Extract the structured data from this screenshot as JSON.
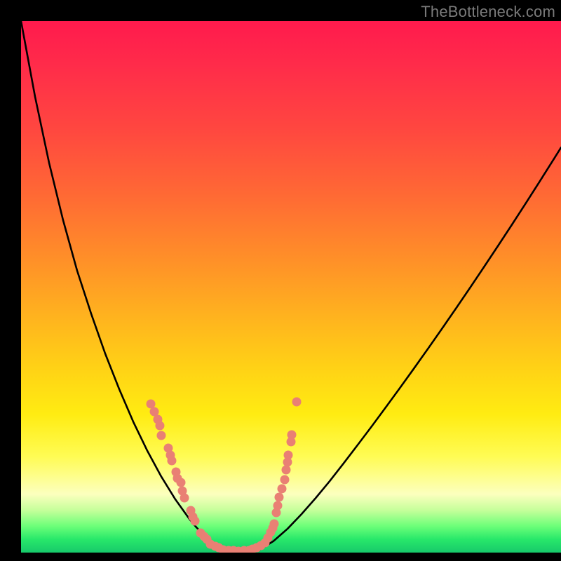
{
  "watermark": {
    "text": "TheBottleneck.com"
  },
  "colors": {
    "background": "#000000",
    "curve": "#000000",
    "marker_fill": "#e98074",
    "marker_stroke": "#c05050",
    "gradient": [
      "#ff1a4d",
      "#ff2b4a",
      "#ff4640",
      "#ff6a34",
      "#ff9028",
      "#ffb41e",
      "#ffd415",
      "#ffec12",
      "#fffc55",
      "#fcffbe",
      "#c6ff9b",
      "#6dff79",
      "#28e86a",
      "#17c96a"
    ]
  },
  "chart_data": {
    "type": "line",
    "title": "",
    "xlabel": "",
    "ylabel": "",
    "xlim": [
      0,
      100
    ],
    "ylim": [
      0,
      100
    ],
    "note": "No numeric axes shown; values are relative 0–100 estimates read from pixel positions. y is plotted downward (0 at top, 100 at bottom of the colored panel).",
    "series": [
      {
        "name": "bottleneck-curve",
        "x": [
          0.0,
          2.6,
          5.19,
          7.79,
          10.39,
          12.99,
          15.58,
          18.18,
          20.78,
          23.38,
          25.97,
          28.57,
          31.17,
          32.47,
          33.77,
          36.36,
          38.96,
          44.16,
          46.75,
          49.35,
          51.95,
          54.55,
          57.14,
          59.74,
          62.34,
          64.94,
          67.53,
          70.13,
          72.73,
          75.32,
          77.92,
          80.52,
          83.12,
          85.71,
          88.31,
          90.91,
          93.51,
          96.1,
          98.7,
          100.0
        ],
        "y": [
          0.0,
          14.25,
          26.65,
          37.47,
          46.97,
          55.07,
          62.55,
          69.25,
          75.38,
          80.84,
          85.7,
          89.98,
          93.67,
          95.25,
          96.57,
          98.81,
          99.92,
          99.49,
          97.84,
          95.52,
          92.76,
          89.76,
          86.59,
          83.2,
          79.75,
          76.25,
          72.69,
          69.08,
          65.41,
          61.7,
          57.93,
          54.11,
          50.23,
          46.31,
          42.33,
          38.31,
          34.23,
          30.1,
          25.92,
          23.81
        ]
      }
    ],
    "markers": {
      "name": "highlight-points",
      "points": [
        {
          "x": 24.03,
          "y": 72.03
        },
        {
          "x": 24.68,
          "y": 73.48
        },
        {
          "x": 25.32,
          "y": 74.93
        },
        {
          "x": 25.71,
          "y": 76.12
        },
        {
          "x": 25.97,
          "y": 77.97
        },
        {
          "x": 27.27,
          "y": 80.34
        },
        {
          "x": 27.66,
          "y": 81.66
        },
        {
          "x": 27.92,
          "y": 82.72
        },
        {
          "x": 28.7,
          "y": 84.83
        },
        {
          "x": 28.96,
          "y": 86.02
        },
        {
          "x": 29.61,
          "y": 86.81
        },
        {
          "x": 29.87,
          "y": 88.39
        },
        {
          "x": 30.26,
          "y": 89.71
        },
        {
          "x": 31.43,
          "y": 92.08
        },
        {
          "x": 31.82,
          "y": 93.27
        },
        {
          "x": 32.21,
          "y": 94.06
        },
        {
          "x": 33.25,
          "y": 96.31
        },
        {
          "x": 33.9,
          "y": 96.97
        },
        {
          "x": 34.42,
          "y": 97.49
        },
        {
          "x": 35.06,
          "y": 98.42
        },
        {
          "x": 35.97,
          "y": 98.81
        },
        {
          "x": 36.62,
          "y": 99.08
        },
        {
          "x": 37.4,
          "y": 99.47
        },
        {
          "x": 38.44,
          "y": 99.6
        },
        {
          "x": 39.35,
          "y": 99.6
        },
        {
          "x": 40.26,
          "y": 99.74
        },
        {
          "x": 41.3,
          "y": 99.6
        },
        {
          "x": 42.21,
          "y": 99.6
        },
        {
          "x": 42.86,
          "y": 99.34
        },
        {
          "x": 43.64,
          "y": 99.08
        },
        {
          "x": 44.42,
          "y": 98.68
        },
        {
          "x": 45.19,
          "y": 98.15
        },
        {
          "x": 45.71,
          "y": 97.23
        },
        {
          "x": 46.23,
          "y": 96.17
        },
        {
          "x": 46.62,
          "y": 95.38
        },
        {
          "x": 46.88,
          "y": 94.59
        },
        {
          "x": 47.27,
          "y": 92.48
        },
        {
          "x": 47.53,
          "y": 91.16
        },
        {
          "x": 47.79,
          "y": 89.58
        },
        {
          "x": 48.31,
          "y": 87.99
        },
        {
          "x": 48.83,
          "y": 86.28
        },
        {
          "x": 49.09,
          "y": 84.43
        },
        {
          "x": 49.35,
          "y": 82.98
        },
        {
          "x": 49.48,
          "y": 81.66
        },
        {
          "x": 50.0,
          "y": 79.16
        },
        {
          "x": 50.13,
          "y": 77.84
        },
        {
          "x": 51.04,
          "y": 71.64
        }
      ]
    }
  }
}
